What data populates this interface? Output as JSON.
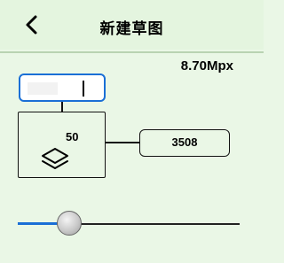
{
  "header": {
    "title": "新建草图",
    "back_icon": "chevron-left-icon"
  },
  "canvas": {
    "megapixels": "8.70Mpx",
    "width_value": "",
    "height_value": "3508",
    "layer_count": "50",
    "layers_icon": "layers-icon"
  },
  "slider": {
    "level": 0.23
  },
  "colors": {
    "accent": "#1a6fd6",
    "background": "#eaf7e6"
  }
}
